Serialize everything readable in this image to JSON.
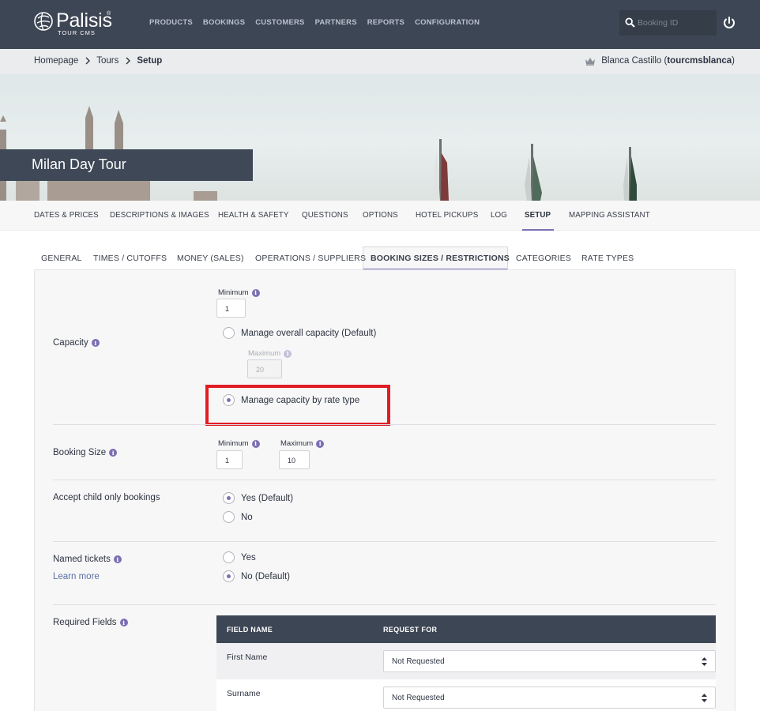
{
  "app": {
    "brand": "Palisis",
    "brand_sub": "TOUR CMS",
    "brand_mark": "®"
  },
  "nav": {
    "items": [
      "PRODUCTS",
      "BOOKINGS",
      "CUSTOMERS",
      "PARTNERS",
      "REPORTS",
      "CONFIGURATION"
    ]
  },
  "search": {
    "placeholder": "Booking ID"
  },
  "breadcrumb": {
    "home": "Homepage",
    "tours": "Tours",
    "current": "Setup"
  },
  "user": {
    "name": "Blanca Castillo (",
    "account": "tourcmsblanca",
    "close": ")"
  },
  "hero": {
    "title": "Milan Day Tour"
  },
  "product_tabs": [
    "DATES & PRICES",
    "DESCRIPTIONS & IMAGES",
    "HEALTH & SAFETY",
    "QUESTIONS",
    "OPTIONS",
    "HOTEL PICKUPS",
    "LOG",
    "SETUP",
    "MAPPING ASSISTANT"
  ],
  "sub_tabs": [
    "GENERAL",
    "TIMES / CUTOFFS",
    "MONEY (SALES)",
    "OPERATIONS / SUPPLIERS",
    "BOOKING SIZES / RESTRICTIONS",
    "CATEGORIES",
    "RATE TYPES"
  ],
  "capacity": {
    "label": "Capacity",
    "minimum_label": "Minimum",
    "minimum_value": "1",
    "option_overall": "Manage overall capacity (Default)",
    "maximum_label": "Maximum",
    "maximum_value": "20",
    "option_by_rate": "Manage capacity by rate type"
  },
  "booking_size": {
    "label": "Booking Size",
    "minimum_label": "Minimum",
    "minimum_value": "1",
    "maximum_label": "Maximum",
    "maximum_value": "10"
  },
  "child_only": {
    "label": "Accept child only bookings",
    "yes": "Yes (Default)",
    "no": "No"
  },
  "named_tickets": {
    "label": "Named tickets",
    "learn_more": "Learn more",
    "yes": "Yes",
    "no": "No (Default)"
  },
  "required_fields": {
    "label": "Required Fields",
    "col_field": "FIELD NAME",
    "col_request": "REQUEST FOR",
    "rows": [
      {
        "field": "First Name",
        "request": "Not Requested"
      },
      {
        "field": "Surname",
        "request": "Not Requested"
      }
    ]
  },
  "colors": {
    "nav_bg": "#3d4654",
    "accent": "#7e6fb3",
    "highlight": "#e11d24"
  }
}
